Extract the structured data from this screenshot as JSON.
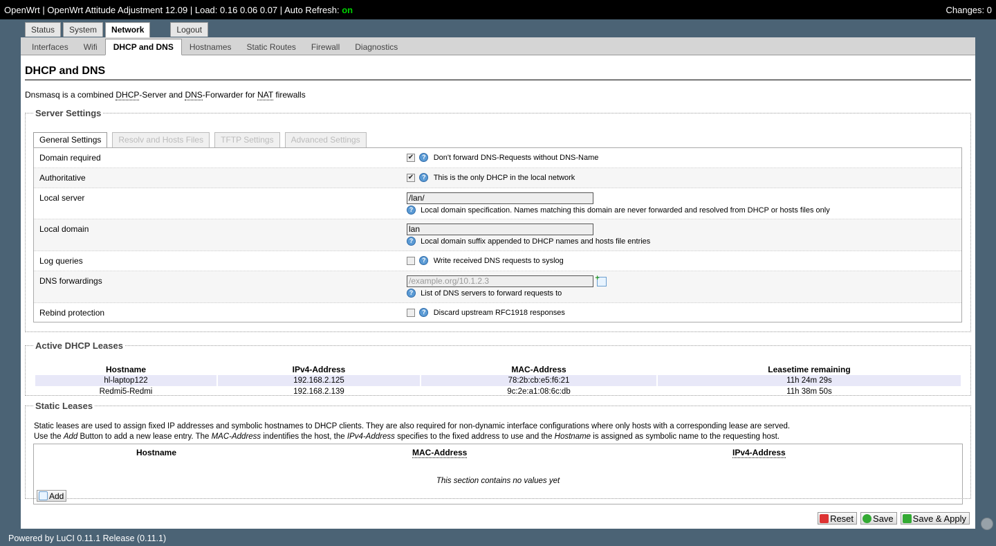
{
  "header": {
    "brand": "OpenWrt",
    "distribution": "OpenWrt Attitude Adjustment 12.09",
    "load_label": "Load:",
    "load": "0.16 0.06 0.07",
    "refresh_label": "Auto Refresh:",
    "refresh_value": "on",
    "changes": "Changes: 0"
  },
  "main_tabs": [
    {
      "label": "Status"
    },
    {
      "label": "System"
    },
    {
      "label": "Network"
    },
    {
      "label": "Logout"
    }
  ],
  "sub_tabs": [
    {
      "label": "Interfaces"
    },
    {
      "label": "Wifi"
    },
    {
      "label": "DHCP and DNS"
    },
    {
      "label": "Hostnames"
    },
    {
      "label": "Static Routes"
    },
    {
      "label": "Firewall"
    },
    {
      "label": "Diagnostics"
    }
  ],
  "page": {
    "title": "DHCP and DNS",
    "desc_pre": "Dnsmasq is a combined ",
    "desc_dhcp": "DHCP",
    "desc_mid1": "-Server and ",
    "desc_dns": "DNS",
    "desc_mid2": "-Forwarder for ",
    "desc_nat": "NAT",
    "desc_post": " firewalls"
  },
  "server": {
    "legend": "Server Settings",
    "tabs": [
      {
        "label": "General Settings"
      },
      {
        "label": "Resolv and Hosts Files"
      },
      {
        "label": "TFTP Settings"
      },
      {
        "label": "Advanced Settings"
      }
    ],
    "domain_required": {
      "label": "Domain required",
      "checked": true,
      "help": "Don't forward DNS-Requests without DNS-Name"
    },
    "authoritative": {
      "label": "Authoritative",
      "checked": true,
      "help": "This is the only DHCP in the local network"
    },
    "local_server": {
      "label": "Local server",
      "value": "/lan/",
      "help": "Local domain specification. Names matching this domain are never forwarded and resolved from DHCP or hosts files only"
    },
    "local_domain": {
      "label": "Local domain",
      "value": "lan",
      "help": "Local domain suffix appended to DHCP names and hosts file entries"
    },
    "log_queries": {
      "label": "Log queries",
      "checked": false,
      "help": "Write received DNS requests to syslog"
    },
    "dns_forwardings": {
      "label": "DNS forwardings",
      "placeholder": "/example.org/10.1.2.3",
      "help": "List of DNS servers to forward requests to"
    },
    "rebind": {
      "label": "Rebind protection",
      "checked": false,
      "help": "Discard upstream RFC1918 responses"
    }
  },
  "leases": {
    "legend": "Active DHCP Leases",
    "columns": [
      "Hostname",
      "IPv4-Address",
      "MAC-Address",
      "Leasetime remaining"
    ],
    "rows": [
      [
        "hl-laptop122",
        "192.168.2.125",
        "78:2b:cb:e5:f6:21",
        "11h 24m 29s"
      ],
      [
        "Redmi5-Redmi",
        "192.168.2.139",
        "9c:2e:a1:08:6c:db",
        "11h 38m 50s"
      ]
    ]
  },
  "static": {
    "legend": "Static Leases",
    "desc1": "Static leases are used to assign fixed IP addresses and symbolic hostnames to DHCP clients. They are also required for non-dynamic interface configurations where only hosts with a corresponding lease are served.",
    "desc2_a": "Use the ",
    "desc2_add": "Add",
    "desc2_b": " Button to add a new lease entry. The ",
    "desc2_mac": "MAC-Address",
    "desc2_c": " indentifies the host, the ",
    "desc2_ip": "IPv4-Address",
    "desc2_d": " specifies to the fixed address to use and the ",
    "desc2_host": "Hostname",
    "desc2_e": " is assigned as symbolic name to the requesting host.",
    "columns": [
      "Hostname",
      "MAC-Address",
      "IPv4-Address"
    ],
    "empty": "This section contains no values yet",
    "add_label": "Add"
  },
  "actions": {
    "reset": "Reset",
    "save": "Save",
    "save_apply": "Save & Apply"
  },
  "footer": "Powered by LuCI 0.11.1 Release (0.11.1)",
  "colors": {
    "refresh_on": "#00d000",
    "background": "#4b6375",
    "help_icon": "#5b9bd5"
  }
}
